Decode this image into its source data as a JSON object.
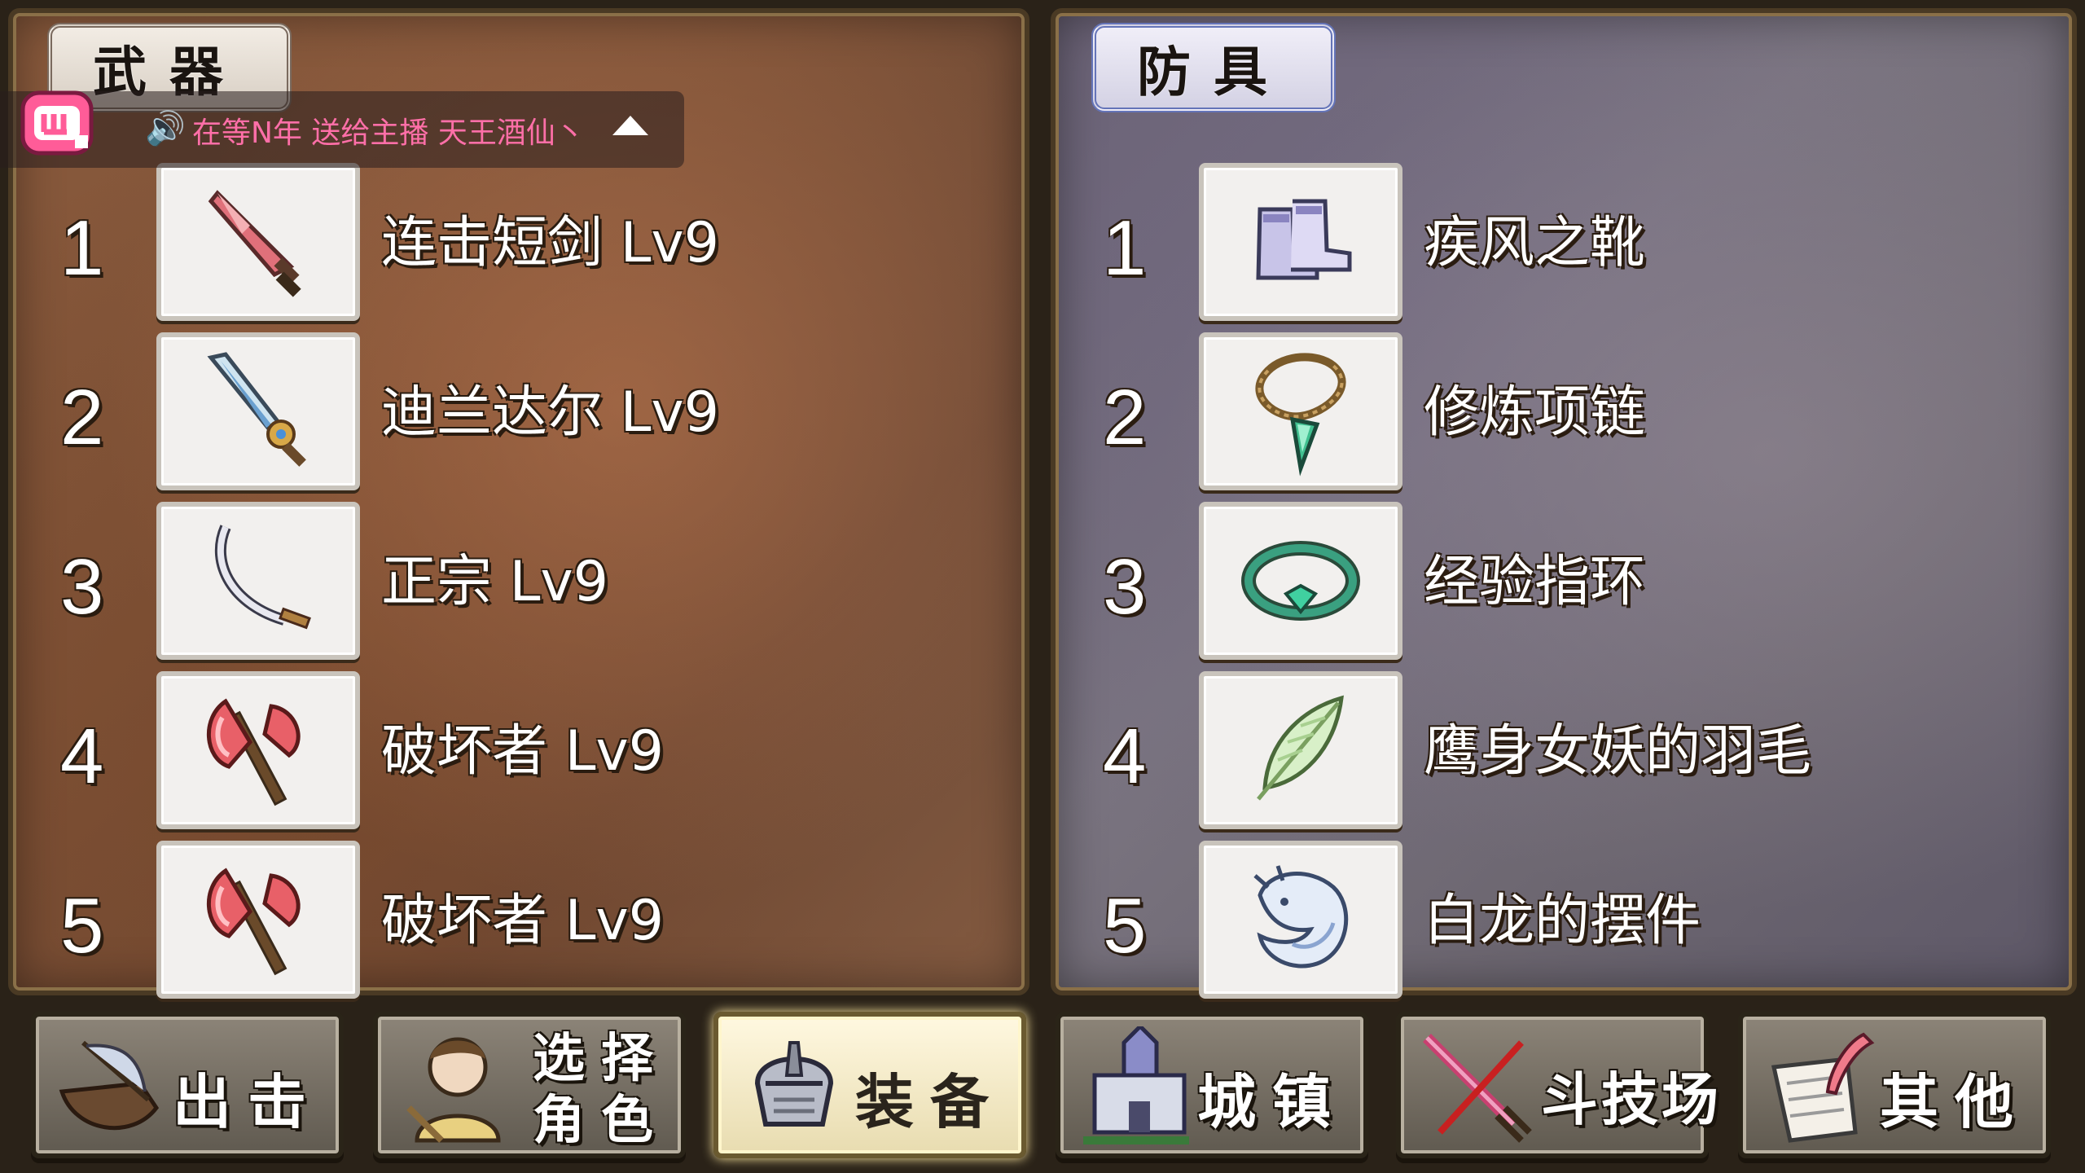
{
  "weapons": {
    "title": "武器",
    "items": [
      {
        "rank": "1",
        "name": "连击短剑 Lv9",
        "icon": "dagger-icon"
      },
      {
        "rank": "2",
        "name": "迪兰达尔 Lv9",
        "icon": "jeweled-sword-icon"
      },
      {
        "rank": "3",
        "name": "正宗 Lv9",
        "icon": "katana-icon"
      },
      {
        "rank": "4",
        "name": "破坏者 Lv9",
        "icon": "axe-icon"
      },
      {
        "rank": "5",
        "name": "破坏者 Lv9",
        "icon": "axe-icon"
      }
    ]
  },
  "armor": {
    "title": "防具",
    "items": [
      {
        "rank": "1",
        "name": "疾风之靴",
        "icon": "boots-icon"
      },
      {
        "rank": "2",
        "name": "修炼项链",
        "icon": "necklace-icon"
      },
      {
        "rank": "3",
        "name": "经验指环",
        "icon": "ring-icon"
      },
      {
        "rank": "4",
        "name": "鹰身女妖的羽毛",
        "icon": "feather-icon"
      },
      {
        "rank": "5",
        "name": "白龙的摆件",
        "icon": "white-dragon-icon"
      }
    ]
  },
  "notice": {
    "text": "在等N年 送给主播 天王酒仙丶"
  },
  "nav": {
    "sortie": "出击",
    "select_char_line1": "选择",
    "select_char_line2": "角色",
    "equipment": "装备",
    "town": "城镇",
    "arena": "斗技场",
    "other": "其他",
    "active": "equipment"
  },
  "colors": {
    "weapon_panel": "#7d5238",
    "armor_panel": "#6c6670",
    "notice_pink": "#ff6fa8",
    "active_button": "#fff8e0"
  }
}
